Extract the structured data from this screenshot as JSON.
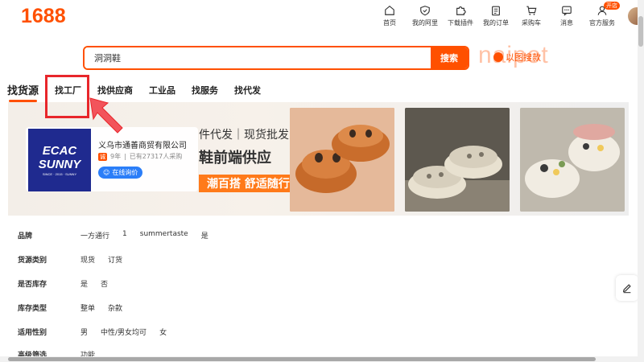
{
  "header": {
    "logo": "1688",
    "nav": [
      {
        "label": "首页",
        "icon": "home-icon"
      },
      {
        "label": "我的阿里",
        "icon": "shield-icon"
      },
      {
        "label": "下载插件",
        "icon": "puzzle-icon"
      },
      {
        "label": "我的订单",
        "icon": "clipboard-icon"
      },
      {
        "label": "采购车",
        "icon": "cart-icon"
      },
      {
        "label": "消息",
        "icon": "message-icon"
      },
      {
        "label": "官方服务",
        "icon": "user-icon",
        "badge": "开店"
      }
    ]
  },
  "search": {
    "value": "洞洞鞋",
    "button_label": "搜索",
    "image_search_label": "以图搜款",
    "watermark": "naipot"
  },
  "tabs": [
    {
      "label": "找货源",
      "active": true
    },
    {
      "label": "找工厂",
      "active": false
    },
    {
      "label": "找供应商",
      "active": false
    },
    {
      "label": "工业品",
      "active": false
    },
    {
      "label": "找服务",
      "active": false
    },
    {
      "label": "找代发",
      "active": false
    }
  ],
  "banner": {
    "shop_logo_lines": [
      "ECAC",
      "SUNNY"
    ],
    "shop_logo_sub": "SINCE · 2015 · SUNNY",
    "shop_name": "义乌市通善商贸有限公司",
    "shop_tag": "诚",
    "shop_years": "9年",
    "shop_buyers": "已有27317人采购",
    "inquiry_label": "在线询价",
    "promo_line1": "件代发｜现货批发",
    "promo_line2": "鞋前端供应",
    "promo_line3": "潮百搭 舒适随行"
  },
  "filters": [
    {
      "label": "品牌",
      "options": [
        "一方通行",
        "1",
        "summertaste",
        "是"
      ]
    },
    {
      "label": "货源类别",
      "options": [
        "现货",
        "订货"
      ]
    },
    {
      "label": "是否库存",
      "options": [
        "是",
        "否"
      ]
    },
    {
      "label": "库存类型",
      "options": [
        "整单",
        "杂款"
      ]
    },
    {
      "label": "适用性别",
      "options": [
        "男",
        "中性/男女均可",
        "女"
      ]
    },
    {
      "label": "高级筛选",
      "options": [
        "功能"
      ]
    }
  ],
  "colors": {
    "brand": "#ff5000",
    "highlight": "#e8262b",
    "inquiry": "#2b7ef8"
  }
}
